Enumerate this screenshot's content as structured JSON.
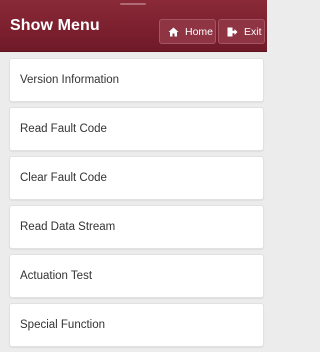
{
  "header": {
    "title": "Show Menu",
    "home_label": "Home",
    "exit_label": "Exit",
    "home_icon": "home-icon",
    "exit_icon": "exit-icon"
  },
  "menu": {
    "items": [
      {
        "label": "Version Information"
      },
      {
        "label": "Read Fault Code"
      },
      {
        "label": "Clear Fault Code"
      },
      {
        "label": "Read Data Stream"
      },
      {
        "label": "Actuation Test"
      },
      {
        "label": "Special Function"
      }
    ]
  },
  "colors": {
    "header": "#7b1f2e",
    "background": "#ececec",
    "item_bg": "#ffffff",
    "item_text": "#333333"
  }
}
